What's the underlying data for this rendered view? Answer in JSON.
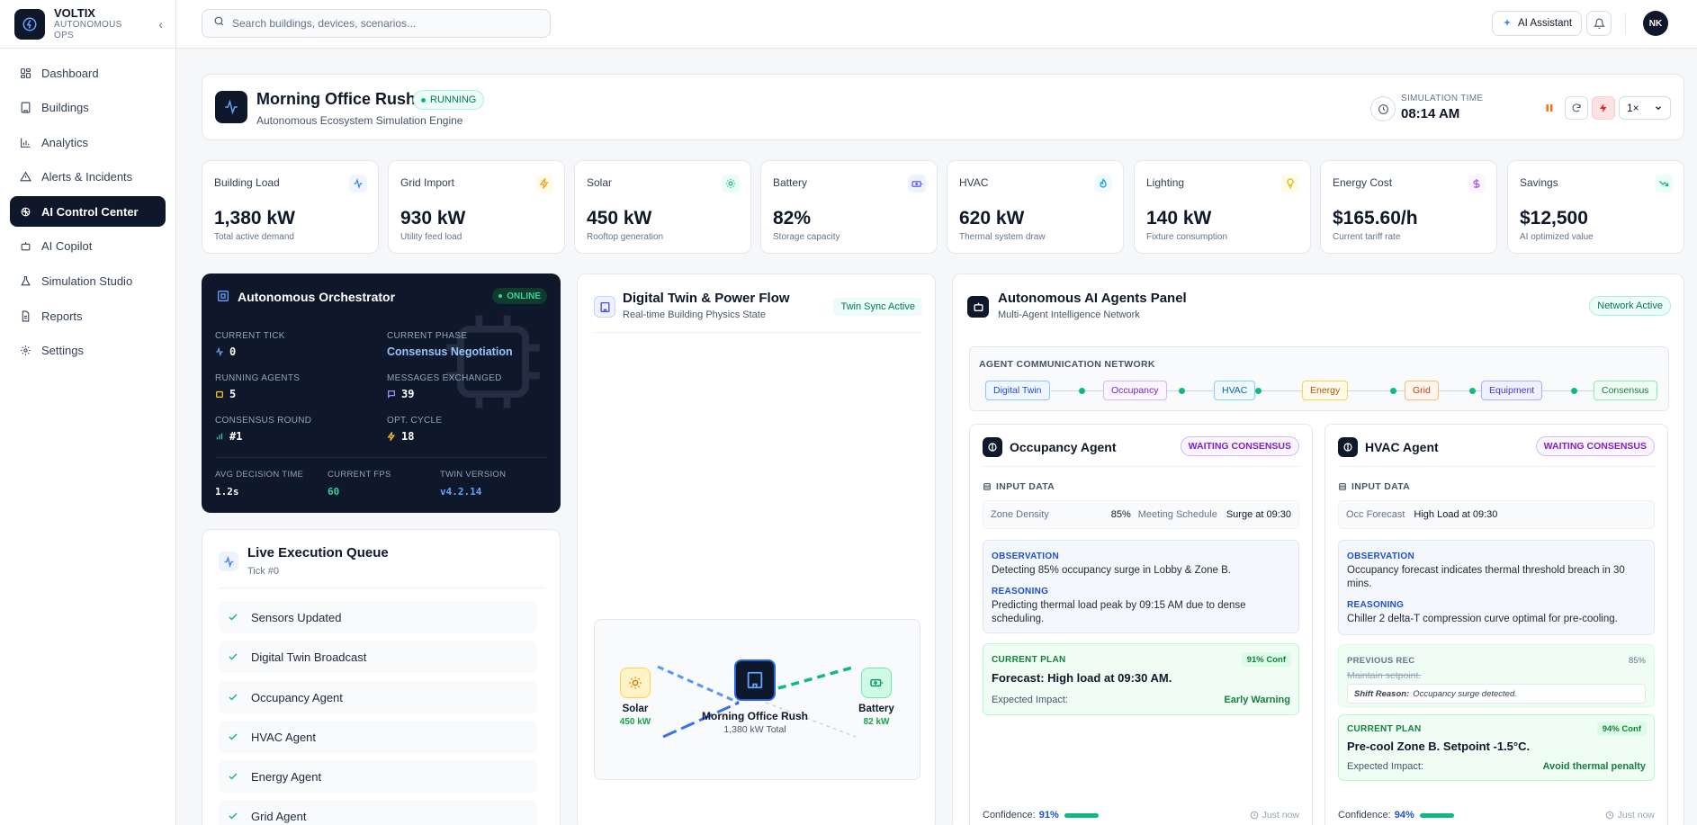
{
  "brand": {
    "name": "VOLTIX",
    "sub": "AUTONOMOUS OPS"
  },
  "nav": [
    {
      "label": "Dashboard",
      "icon": "dashboard-icon"
    },
    {
      "label": "Buildings",
      "icon": "building-icon"
    },
    {
      "label": "Analytics",
      "icon": "bar-chart-icon"
    },
    {
      "label": "Alerts & Incidents",
      "icon": "alert-triangle-icon"
    },
    {
      "label": "AI Control Center",
      "icon": "brain-icon",
      "active": true
    },
    {
      "label": "AI Copilot",
      "icon": "bot-icon"
    },
    {
      "label": "Simulation Studio",
      "icon": "flask-icon"
    },
    {
      "label": "Reports",
      "icon": "file-icon"
    },
    {
      "label": "Settings",
      "icon": "gear-icon"
    }
  ],
  "topbar": {
    "search_placeholder": "Search buildings, devices, scenarios...",
    "ai_assistant": "AI Assistant",
    "avatar_initials": "NK"
  },
  "scenario": {
    "title": "Morning Office Rush",
    "status": "RUNNING",
    "subtitle": "Autonomous Ecosystem Simulation Engine",
    "sim_time_label": "SIMULATION TIME",
    "sim_time": "08:14 AM",
    "speed": "1×"
  },
  "metrics": [
    {
      "label": "Building Load",
      "value": "1,380 kW",
      "sub": "Total active demand",
      "icon": "activity-icon",
      "color": "#3b82f6",
      "bg": "#eff6ff"
    },
    {
      "label": "Grid Import",
      "value": "930 kW",
      "sub": "Utility feed load",
      "icon": "bolt-icon",
      "color": "#f59e0b",
      "bg": "#fffbeb"
    },
    {
      "label": "Solar",
      "value": "450 kW",
      "sub": "Rooftop generation",
      "icon": "sun-icon",
      "color": "#10b981",
      "bg": "#ecfdf5"
    },
    {
      "label": "Battery",
      "value": "82%",
      "sub": "Storage capacity",
      "icon": "battery-icon",
      "color": "#6366f1",
      "bg": "#eef2ff"
    },
    {
      "label": "HVAC",
      "value": "620 kW",
      "sub": "Thermal system draw",
      "icon": "flame-icon",
      "color": "#0ea5e9",
      "bg": "#f0f9ff"
    },
    {
      "label": "Lighting",
      "value": "140 kW",
      "sub": "Fixture consumption",
      "icon": "bulb-icon",
      "color": "#eab308",
      "bg": "#fefce8"
    },
    {
      "label": "Energy Cost",
      "value": "$165.60/h",
      "sub": "Current tariff rate",
      "icon": "dollar-icon",
      "color": "#a855f7",
      "bg": "#faf5ff"
    },
    {
      "label": "Savings",
      "value": "$12,500",
      "sub": "AI optimized value",
      "icon": "trend-down-icon",
      "color": "#10b981",
      "bg": "#ecfdf5"
    }
  ],
  "orchestrator": {
    "title": "Autonomous Orchestrator",
    "status": "ONLINE",
    "current_tick_label": "CURRENT TICK",
    "current_tick": "0",
    "current_phase_label": "CURRENT PHASE",
    "current_phase": "Consensus Negotiation",
    "running_agents_label": "RUNNING AGENTS",
    "running_agents": "5",
    "messages_label": "MESSAGES EXCHANGED",
    "messages": "39",
    "consensus_label": "CONSENSUS ROUND",
    "consensus": "#1",
    "opt_cycle_label": "OPT. CYCLE",
    "opt_cycle": "18",
    "avg_decision_label": "AVG DECISION TIME",
    "avg_decision": "1.2s",
    "fps_label": "CURRENT FPS",
    "fps": "60",
    "twin_version_label": "TWIN VERSION",
    "twin_version": "v4.2.14"
  },
  "queue": {
    "title": "Live Execution Queue",
    "sub": "Tick #0",
    "items": [
      "Sensors Updated",
      "Digital Twin Broadcast",
      "Occupancy Agent",
      "HVAC Agent",
      "Energy Agent",
      "Grid Agent"
    ]
  },
  "twin": {
    "title": "Digital Twin & Power Flow",
    "sub": "Real-time Building Physics State",
    "badge": "Twin Sync Active",
    "solar_label": "Solar",
    "solar_value": "450 kW",
    "building_label": "Morning Office Rush",
    "building_value": "1,380 kW Total",
    "battery_label": "Battery",
    "battery_value": "82 kW"
  },
  "agents_panel": {
    "title": "Autonomous AI Agents Panel",
    "sub": "Multi-Agent Intelligence Network",
    "badge": "Network Active",
    "network_title": "AGENT COMMUNICATION NETWORK",
    "network": [
      "Digital Twin",
      "Occupancy",
      "HVAC",
      "Energy",
      "Grid",
      "Equipment",
      "Consensus"
    ]
  },
  "occupancy_agent": {
    "title": "Occupancy Agent",
    "status": "WAITING CONSENSUS",
    "input_label": "INPUT DATA",
    "k1": "Zone Density",
    "v1": "85%",
    "k2": "Meeting Schedule",
    "v2": "Surge at 09:30",
    "obs_label": "OBSERVATION",
    "obs": "Detecting 85% occupancy surge in Lobby & Zone B.",
    "reason_label": "REASONING",
    "reason": "Predicting thermal load peak by 09:15 AM due to dense scheduling.",
    "plan_label": "CURRENT PLAN",
    "plan_conf": "91% Conf",
    "plan": "Forecast: High load at 09:30 AM.",
    "impact_label": "Expected Impact:",
    "impact": "Early Warning",
    "confidence_label": "Confidence:",
    "confidence": "91%",
    "confidence_value": 0.91,
    "time": "Just now"
  },
  "hvac_agent": {
    "title": "HVAC Agent",
    "status": "WAITING CONSENSUS",
    "input_label": "INPUT DATA",
    "k1": "Occ Forecast",
    "v1": "High Load at 09:30",
    "obs_label": "OBSERVATION",
    "obs": "Occupancy forecast indicates thermal threshold breach in 30 mins.",
    "reason_label": "REASONING",
    "reason": "Chiller 2 delta-T compression curve optimal for pre-cooling.",
    "prev_label": "PREVIOUS REC",
    "prev_pct": "85%",
    "prev_old": "Maintain setpoint.",
    "shift_label": "Shift Reason:",
    "shift": "Occupancy surge detected.",
    "plan_label": "CURRENT PLAN",
    "plan_conf": "94% Conf",
    "plan": "Pre-cool Zone B. Setpoint -1.5°C.",
    "impact_label": "Expected Impact:",
    "impact": "Avoid thermal penalty",
    "confidence_label": "Confidence:",
    "confidence": "94%",
    "confidence_value": 0.94,
    "time": "Just now"
  }
}
